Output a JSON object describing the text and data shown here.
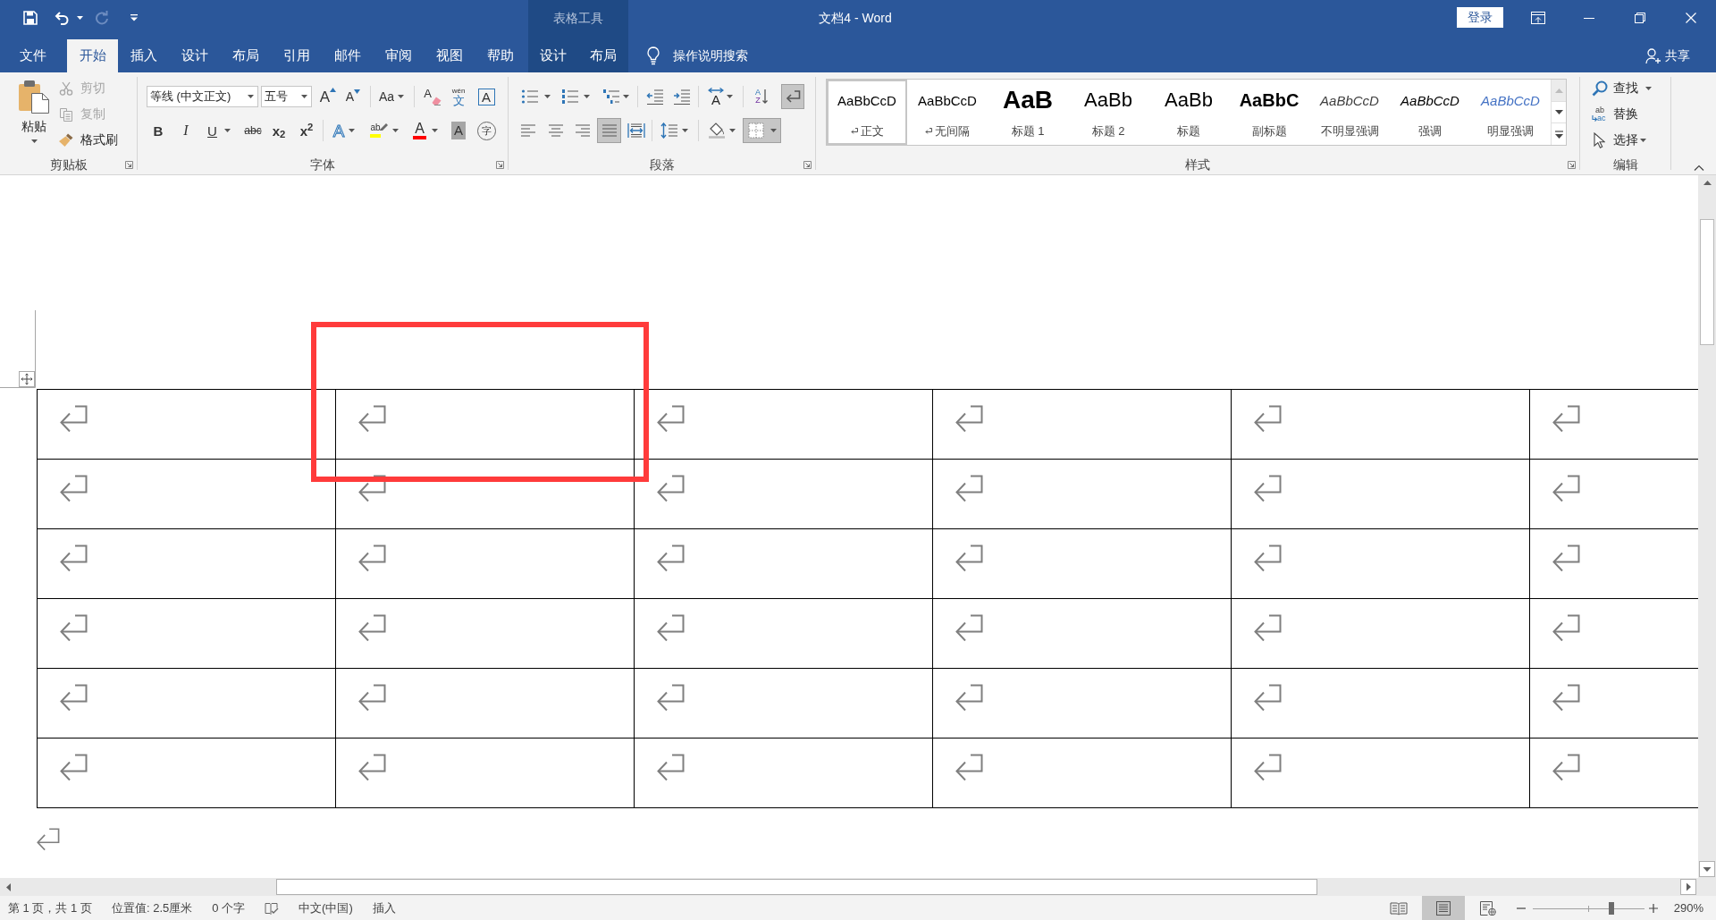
{
  "window": {
    "title": "文档4 - Word",
    "sign_in": "登录",
    "share": "共享"
  },
  "quick_access": [
    {
      "kind": "save",
      "disabled": false
    },
    {
      "kind": "undo",
      "disabled": false
    },
    {
      "kind": "redo",
      "disabled": true
    },
    {
      "kind": "customize",
      "disabled": false
    }
  ],
  "tabs": [
    {
      "label": "文件",
      "selected": false
    },
    {
      "label": "开始",
      "selected": true
    },
    {
      "label": "插入",
      "selected": false
    },
    {
      "label": "设计",
      "selected": false
    },
    {
      "label": "布局",
      "selected": false
    },
    {
      "label": "引用",
      "selected": false
    },
    {
      "label": "邮件",
      "selected": false
    },
    {
      "label": "审阅",
      "selected": false
    },
    {
      "label": "视图",
      "selected": false
    },
    {
      "label": "帮助",
      "selected": false
    }
  ],
  "table_tools": {
    "label": "表格工具",
    "tabs": [
      {
        "label": "设计",
        "selected": false
      },
      {
        "label": "布局",
        "selected": false
      }
    ]
  },
  "tell_me": {
    "label": "操作说明搜索"
  },
  "ribbon": {
    "clipboard": {
      "label": "剪贴板",
      "paste": "粘贴",
      "commands": [
        {
          "kind": "cut",
          "label": "剪切",
          "disabled": true
        },
        {
          "kind": "copy",
          "label": "复制",
          "disabled": true
        },
        {
          "kind": "format-painter",
          "label": "格式刷",
          "disabled": false
        }
      ]
    },
    "font": {
      "label": "字体",
      "font_name": "等线 (中文正文)",
      "font_size": "五号",
      "row_1": [
        {
          "kind": "grow",
          "glyph": "A"
        },
        {
          "kind": "shrink",
          "glyph": "A"
        },
        {
          "kind": "change-case",
          "glyph": "Aa"
        },
        {
          "kind": "clear",
          "glyph": "A"
        },
        {
          "kind": "phonetic",
          "glyph": "wén",
          "base": "文"
        },
        {
          "kind": "char-border",
          "glyph": "A"
        }
      ],
      "row_2": [
        {
          "kind": "bold",
          "glyph": "B"
        },
        {
          "kind": "italic",
          "glyph": "I"
        },
        {
          "kind": "underline",
          "glyph": "U"
        },
        {
          "kind": "strike",
          "glyph": "abc"
        },
        {
          "kind": "subscript",
          "glyph": "x$_{2}$"
        },
        {
          "kind": "superscript",
          "glyph": "x$^{2}$"
        },
        {
          "kind": "text-effects",
          "glyph": "A"
        },
        {
          "kind": "highlight",
          "glyph": "ab"
        },
        {
          "kind": "font-color",
          "glyph": "A"
        },
        {
          "kind": "char-shading",
          "glyph": "A"
        },
        {
          "kind": "enclose",
          "glyph": "字"
        }
      ]
    },
    "paragraph": {
      "label": "段落",
      "row_1": [
        {
          "kind": "bullets",
          "selected": false
        },
        {
          "kind": "numbering",
          "selected": false
        },
        {
          "kind": "multilevel",
          "selected": false
        },
        {
          "kind": "decrease-indent",
          "selected": false
        },
        {
          "kind": "increase-indent",
          "selected": false
        },
        {
          "kind": "chinese-layout",
          "glyph": "A",
          "selected": false
        },
        {
          "kind": "sort",
          "glyph": "A",
          "glyph_2": "Z",
          "selected": false
        },
        {
          "kind": "show-marks",
          "selected": true
        }
      ],
      "row_2": [
        {
          "kind": "align-left",
          "selected": false
        },
        {
          "kind": "align-center",
          "selected": false
        },
        {
          "kind": "align-right",
          "selected": false
        },
        {
          "kind": "justify",
          "selected": true
        },
        {
          "kind": "distributed",
          "selected": false
        },
        {
          "kind": "line-spacing",
          "selected": false
        },
        {
          "kind": "shading",
          "selected": false
        },
        {
          "kind": "borders",
          "selected": true
        }
      ]
    },
    "styles": {
      "label": "样式",
      "items": [
        {
          "kind": "normal",
          "preview": "AaBbCcD",
          "label": "正文",
          "paragraph_mark": true,
          "selected": true
        },
        {
          "kind": "no-spacing",
          "preview": "AaBbCcD",
          "label": "无间隔",
          "paragraph_mark": true,
          "selected": false
        },
        {
          "kind": "heading-1",
          "preview": "AaB",
          "label": "标题 1",
          "paragraph_mark": false,
          "selected": false
        },
        {
          "kind": "heading-2",
          "preview": "AaBb",
          "label": "标题 2",
          "paragraph_mark": false,
          "selected": false
        },
        {
          "kind": "title",
          "preview": "AaBb",
          "label": "标题",
          "paragraph_mark": false,
          "selected": false
        },
        {
          "kind": "subtitle",
          "preview": "AaBbC",
          "label": "副标题",
          "paragraph_mark": false,
          "selected": false
        },
        {
          "kind": "subtle-emphasis",
          "preview": "AaBbCcD",
          "label": "不明显强调",
          "paragraph_mark": false,
          "selected": false
        },
        {
          "kind": "emphasis",
          "preview": "AaBbCcD",
          "label": "强调",
          "paragraph_mark": false,
          "selected": false
        },
        {
          "kind": "intense-emphasis",
          "preview": "AaBbCcD",
          "label": "明显强调",
          "paragraph_mark": false,
          "selected": false
        }
      ]
    },
    "editing": {
      "label": "编辑",
      "items": [
        {
          "kind": "find",
          "label": "查找"
        },
        {
          "kind": "replace",
          "label": "替换",
          "glyph": "ab",
          "glyph_2": "ac"
        },
        {
          "kind": "select",
          "label": "选择"
        }
      ]
    }
  },
  "document": {
    "table": {
      "rows": [
        {
          "cells": [
            {
              "paragraph_mark": true
            },
            {
              "paragraph_mark": true
            },
            {
              "paragraph_mark": true
            },
            {
              "paragraph_mark": true
            },
            {
              "paragraph_mark": true
            },
            {
              "paragraph_mark": true
            }
          ]
        },
        {
          "cells": [
            {
              "paragraph_mark": true
            },
            {
              "paragraph_mark": true
            },
            {
              "paragraph_mark": true
            },
            {
              "paragraph_mark": true
            },
            {
              "paragraph_mark": true
            },
            {
              "paragraph_mark": true
            }
          ]
        },
        {
          "cells": [
            {
              "paragraph_mark": true
            },
            {
              "paragraph_mark": true
            },
            {
              "paragraph_mark": true
            },
            {
              "paragraph_mark": true
            },
            {
              "paragraph_mark": true
            },
            {
              "paragraph_mark": true
            }
          ]
        },
        {
          "cells": [
            {
              "paragraph_mark": true
            },
            {
              "paragraph_mark": true
            },
            {
              "paragraph_mark": true
            },
            {
              "paragraph_mark": true
            },
            {
              "paragraph_mark": true
            },
            {
              "paragraph_mark": true
            }
          ]
        },
        {
          "cells": [
            {
              "paragraph_mark": true
            },
            {
              "paragraph_mark": true
            },
            {
              "paragraph_mark": true
            },
            {
              "paragraph_mark": true
            },
            {
              "paragraph_mark": true
            },
            {
              "paragraph_mark": true
            }
          ]
        },
        {
          "cells": [
            {
              "paragraph_mark": true
            },
            {
              "paragraph_mark": true
            },
            {
              "paragraph_mark": true
            },
            {
              "paragraph_mark": true
            },
            {
              "paragraph_mark": true
            },
            {
              "paragraph_mark": true
            }
          ]
        }
      ]
    },
    "end_paragraph_mark": true,
    "annotation": {
      "kind": "rectangle"
    }
  },
  "status_bar": {
    "items": [
      {
        "kind": "text",
        "text": "第 1 页，共 1 页"
      },
      {
        "kind": "text",
        "text": "位置值: 2.5厘米"
      },
      {
        "kind": "text",
        "text": "0 个字"
      },
      {
        "kind": "proofing"
      },
      {
        "kind": "text",
        "text": "中文(中国)"
      },
      {
        "kind": "text",
        "text": "插入"
      }
    ],
    "views": [
      {
        "kind": "read",
        "selected": false
      },
      {
        "kind": "print",
        "selected": true
      },
      {
        "kind": "web",
        "selected": false
      }
    ],
    "zoom": {
      "level": 0.72,
      "reading": "290%"
    }
  }
}
